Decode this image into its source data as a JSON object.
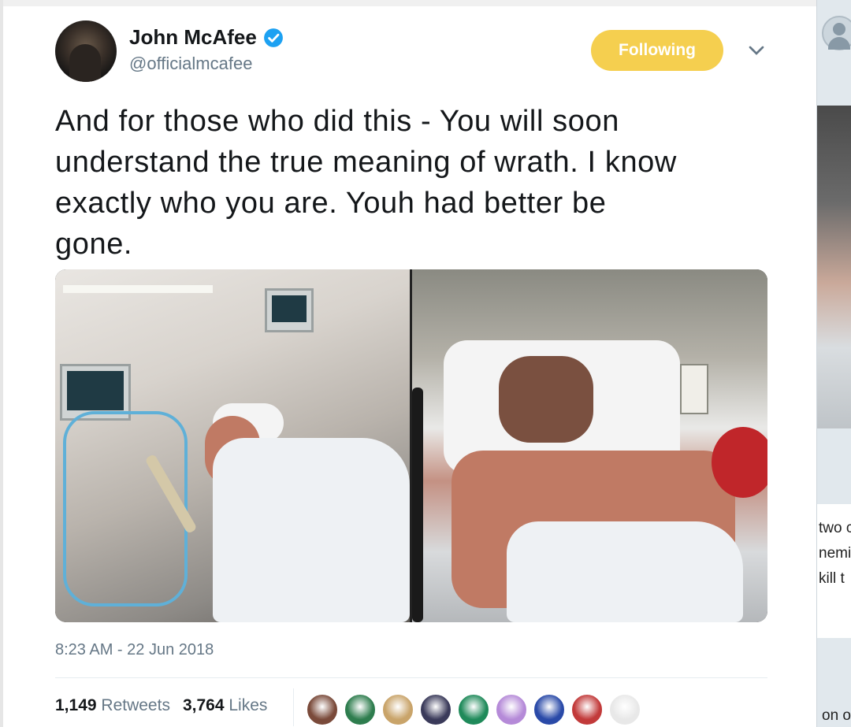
{
  "tweet": {
    "display_name": "John McAfee",
    "handle": "@officialmcafee",
    "follow_label": "Following",
    "text": "And for those who did this - You will soon\nunderstand the true meaning of wrath. I know\nexactly who you  are. Youh had better be\ngone.",
    "timestamp": "8:23 AM - 22 Jun 2018",
    "retweets_count": "1,149",
    "retweets_label": "Retweets",
    "likes_count": "3,764",
    "likes_label": "Likes",
    "verified_icon": "verified-badge-icon",
    "colors": {
      "follow_button": "#f5cf4f",
      "verified": "#1da1f2",
      "secondary_text": "#657786"
    },
    "liker_avatars": [
      {
        "color": "#7a4a3a"
      },
      {
        "color": "#2e7d4e"
      },
      {
        "color": "#c9a46a"
      },
      {
        "color": "#3a3a5a"
      },
      {
        "color": "#1f8a5a"
      },
      {
        "color": "#b58ad8"
      },
      {
        "color": "#2a4aa8"
      },
      {
        "color": "#c23a3a"
      },
      {
        "color": "#e8e8e8"
      }
    ]
  },
  "side_panel": {
    "lines": [
      "two c",
      "nemi",
      "kill t"
    ],
    "footer": "on of"
  }
}
